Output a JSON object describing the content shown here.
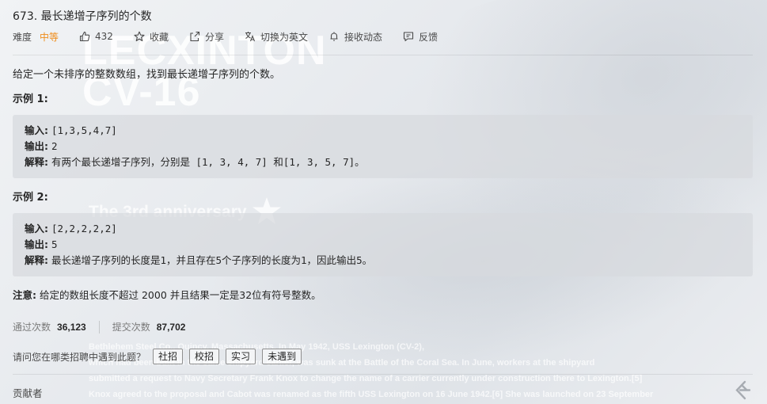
{
  "problem": {
    "title": "673. 最长递增子序列的个数",
    "difficulty_label": "难度",
    "difficulty": "中等",
    "likes": "432",
    "favorite_label": "收藏",
    "share_label": "分享",
    "translate_label": "切换为英文",
    "subscribe_label": "接收动态",
    "feedback_label": "反馈",
    "description": "给定一个未排序的整数数组，找到最长递增子序列的个数。"
  },
  "examples": [
    {
      "title": "示例 1:",
      "input_label": "输入:",
      "input": "[1,3,5,4,7]",
      "output_label": "输出:",
      "output": "2",
      "explain_label": "解释:",
      "explain": "有两个最长递增子序列，分别是 [1, 3, 4, 7] 和[1, 3, 5, 7]。"
    },
    {
      "title": "示例 2:",
      "input_label": "输入:",
      "input": "[2,2,2,2,2]",
      "output_label": "输出:",
      "output": "5",
      "explain_label": "解释:",
      "explain": "最长递增子序列的长度是1，并且存在5个子序列的长度为1，因此输出5。"
    }
  ],
  "note": {
    "label": "注意:",
    "text": "给定的数组长度不超过 2000 并且结果一定是32位有符号整数。"
  },
  "stats": {
    "accepted_label": "通过次数",
    "accepted": "36,123",
    "submissions_label": "提交次数",
    "submissions": "87,702"
  },
  "recruit": {
    "question": "请问您在哪类招聘中遇到此题？",
    "options": [
      "社招",
      "校招",
      "实习",
      "未遇到"
    ]
  },
  "contributors_label": "贡献者",
  "background": {
    "watermark_line1": "LECXINTON",
    "watermark_line2": "CV-16",
    "anniversary": "The 3rd anniversary",
    "text_lines": [
      "                                   Bethlehem Steel Co., Quincy, Massachusetts. In May 1942, USS Lexington (CV-2),",
      "which had been built in the same shipyard           earlier, was sunk at the Battle of the Coral Sea. In June, workers at the shipyard",
      "submitted a request to Navy Secretary Frank Knox to change the name of a carrier currently under construction there to Lexington.[5]",
      "Knox agreed to the proposal and Cabot was renamed as the fifth USS Lexington on 16 June 1942.[6] She was launched on 23 September"
    ]
  },
  "colors": {
    "difficulty_medium": "#ef8c1a",
    "text": "#262626",
    "muted": "#7a7a7a",
    "code_bg": "#d7dade"
  }
}
